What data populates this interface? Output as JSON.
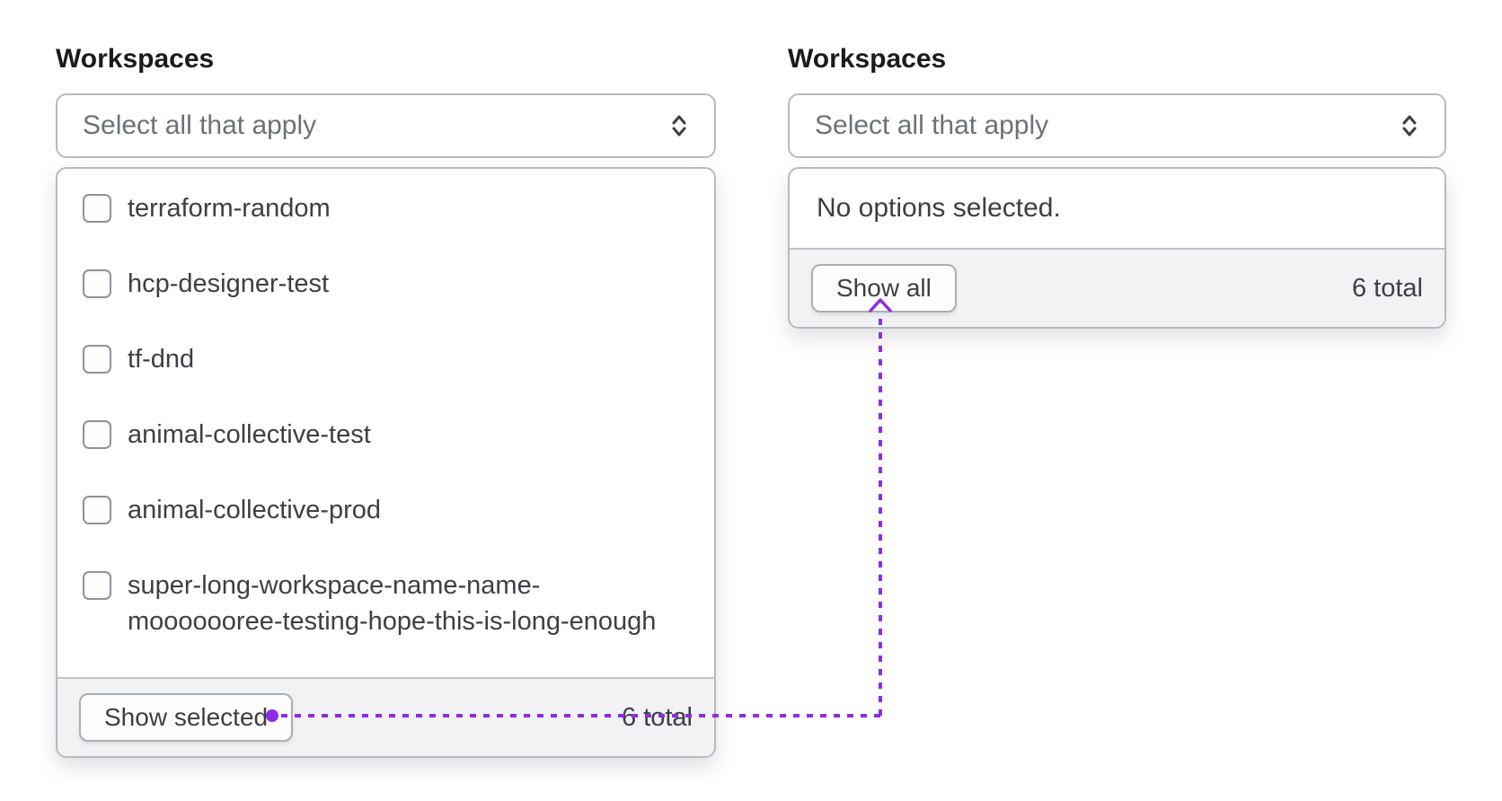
{
  "connector": {
    "color": "#8f2be5"
  },
  "left": {
    "label": "Workspaces",
    "placeholder": "Select all that apply",
    "options": [
      "terraform-random",
      "hcp-designer-test",
      "tf-dnd",
      "animal-collective-test",
      "animal-collective-prod",
      "super-long-workspace-name-name-mooooooree-testing-hope-this-is-long-enough"
    ],
    "footer": {
      "button_label": "Show selected",
      "total_label": "6 total"
    }
  },
  "right": {
    "label": "Workspaces",
    "placeholder": "Select all that apply",
    "empty_text": "No options selected.",
    "footer": {
      "button_label": "Show all",
      "total_label": "6 total"
    }
  }
}
